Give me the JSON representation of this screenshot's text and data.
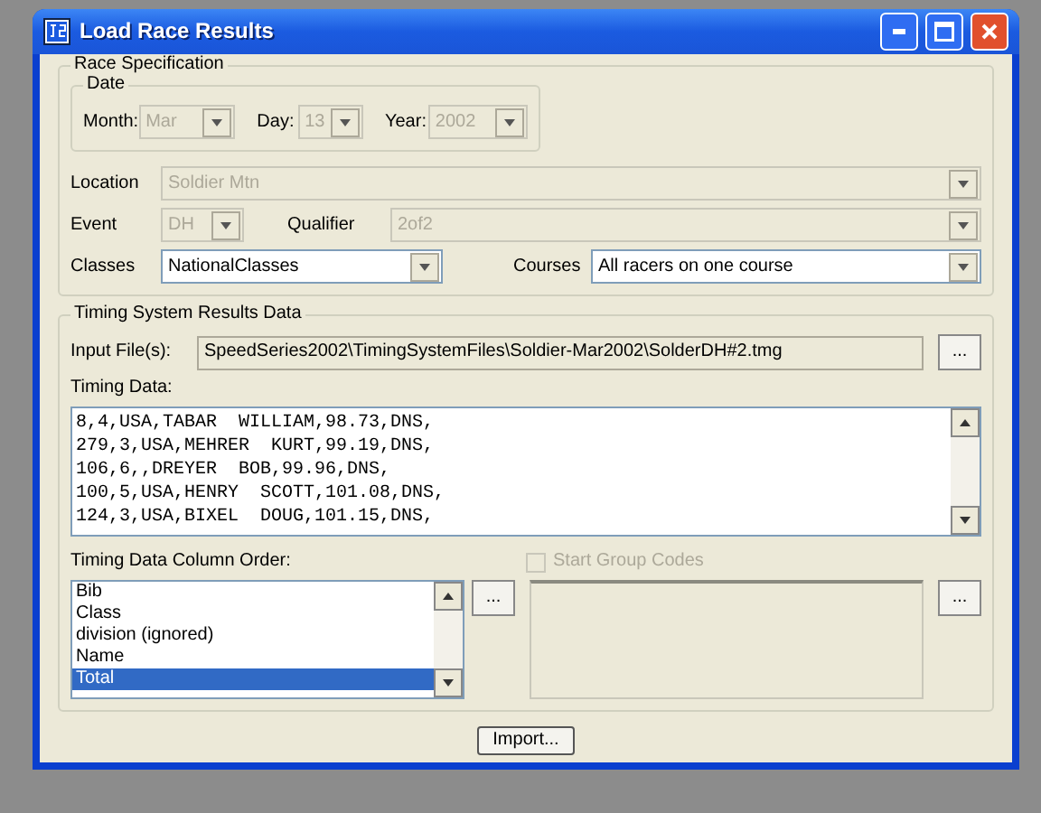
{
  "window": {
    "title": "Load Race Results"
  },
  "race_specification": {
    "title": "Race Specification",
    "date": {
      "title": "Date",
      "fields": [
        {
          "label": "Month:",
          "value": "Mar",
          "disabled": true
        },
        {
          "label": "Day:",
          "value": "13",
          "disabled": true
        },
        {
          "label": "Year:",
          "value": "2002",
          "disabled": true
        }
      ]
    },
    "location": {
      "label": "Location",
      "value": "Soldier Mtn",
      "disabled": true
    },
    "event": {
      "label": "Event",
      "value": "DH",
      "disabled": true
    },
    "qualifier": {
      "label": "Qualifier",
      "value": "2of2",
      "disabled": true
    },
    "classes": {
      "label": "Classes",
      "value": "NationalClasses",
      "disabled": false
    },
    "courses": {
      "label": "Courses",
      "value": "All racers on one course",
      "disabled": false
    }
  },
  "timing_system": {
    "title": "Timing System Results Data",
    "input_files": {
      "label": "Input File(s):",
      "value": "SpeedSeries2002\\TimingSystemFiles\\Soldier-Mar2002\\SolderDH#2.tmg",
      "button": "..."
    },
    "timing_data": {
      "label": "Timing Data:",
      "lines": [
        "8,4,USA,TABAR  WILLIAM,98.73,DNS,",
        "279,3,USA,MEHRER  KURT,99.19,DNS,",
        "106,6,,DREYER  BOB,99.96,DNS,",
        "100,5,USA,HENRY  SCOTT,101.08,DNS,",
        "124,3,USA,BIXEL  DOUG,101.15,DNS,"
      ]
    },
    "column_order": {
      "label": "Timing Data Column Order:",
      "button": "...",
      "items": [
        {
          "label": "Bib",
          "selected": false
        },
        {
          "label": "Class",
          "selected": false
        },
        {
          "label": "division (ignored)",
          "selected": false
        },
        {
          "label": "Name",
          "selected": false
        },
        {
          "label": "Total",
          "selected": true
        }
      ]
    },
    "start_group_codes": {
      "label": "Start Group Codes",
      "checked": false,
      "disabled": true,
      "button": "..."
    }
  },
  "buttons": [
    "Import..."
  ]
}
